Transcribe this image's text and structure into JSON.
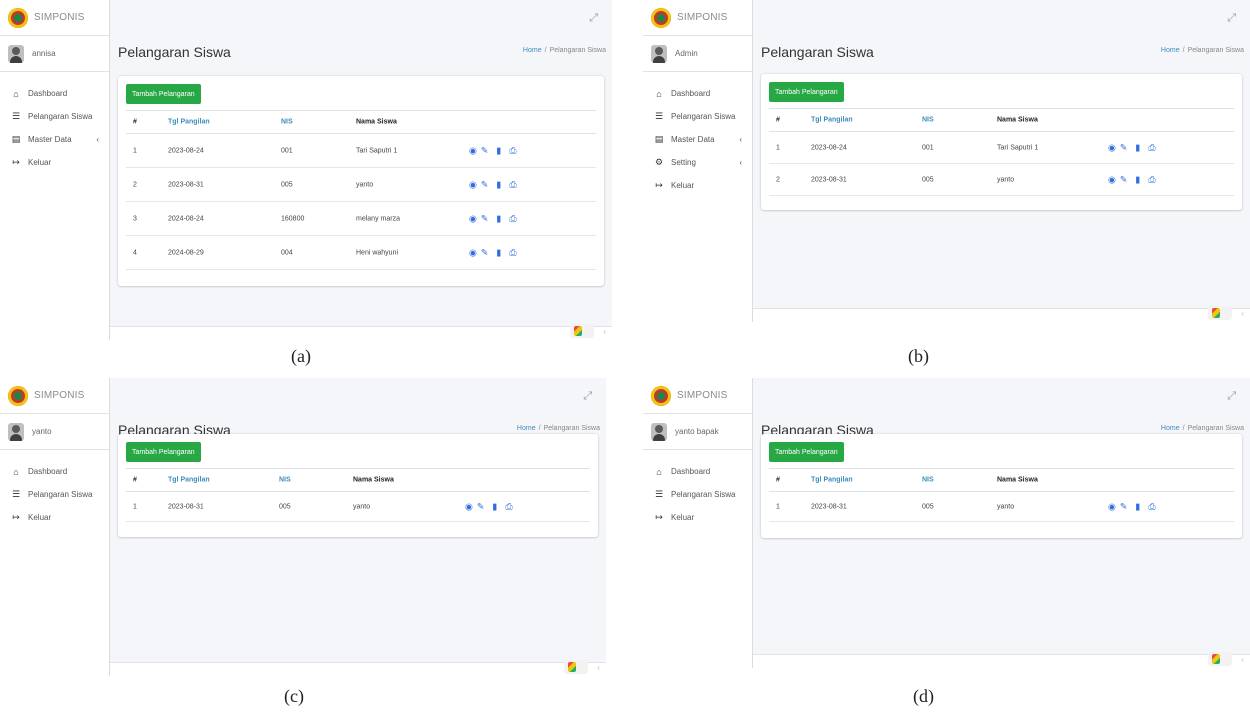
{
  "panels": [
    {
      "caption": "(a)",
      "brand": "SIMPONIS",
      "user": "annisa",
      "menu": [
        {
          "icon": "home-icon",
          "glyph": "⌂",
          "label": "Dashboard",
          "chevron": false
        },
        {
          "icon": "list-icon",
          "glyph": "☰",
          "label": "Pelangaran Siswa",
          "chevron": false
        },
        {
          "icon": "database-icon",
          "glyph": "▤",
          "label": "Master Data",
          "chevron": true
        },
        {
          "icon": "logout-icon",
          "glyph": "↦",
          "label": "Keluar",
          "chevron": false
        }
      ],
      "title": "Pelangaran Siswa",
      "breadcrumb": {
        "home": "Home",
        "sep": "/",
        "current": "Pelangaran Siswa"
      },
      "add_button": "Tambah Pelangaran",
      "headers": [
        "#",
        "Tgl Pangilan",
        "NIS",
        "Nama Siswa"
      ],
      "rows": [
        [
          "1",
          "2023-08-24",
          "001",
          "Tari Saputri 1"
        ],
        [
          "2",
          "2023-08-31",
          "005",
          "yanto"
        ],
        [
          "3",
          "2024-08-24",
          "160800",
          "melany marza"
        ],
        [
          "4",
          "2024-08-29",
          "004",
          "Heni wahyuni"
        ]
      ]
    },
    {
      "caption": "(b)",
      "brand": "SIMPONIS",
      "user": "Admin",
      "menu": [
        {
          "icon": "home-icon",
          "glyph": "⌂",
          "label": "Dashboard",
          "chevron": false
        },
        {
          "icon": "list-icon",
          "glyph": "☰",
          "label": "Pelangaran Siswa",
          "chevron": false
        },
        {
          "icon": "database-icon",
          "glyph": "▤",
          "label": "Master Data",
          "chevron": true
        },
        {
          "icon": "gear-icon",
          "glyph": "⚙",
          "label": "Setting",
          "chevron": true
        },
        {
          "icon": "logout-icon",
          "glyph": "↦",
          "label": "Keluar",
          "chevron": false
        }
      ],
      "title": "Pelangaran Siswa",
      "breadcrumb": {
        "home": "Home",
        "sep": "/",
        "current": "Pelangaran Siswa"
      },
      "add_button": "Tambah Pelangaran",
      "headers": [
        "#",
        "Tgl Pangilan",
        "NIS",
        "Nama Siswa"
      ],
      "rows": [
        [
          "1",
          "2023-08-24",
          "001",
          "Tari Saputri 1"
        ],
        [
          "2",
          "2023-08-31",
          "005",
          "yanto"
        ]
      ]
    },
    {
      "caption": "(c)",
      "brand": "SIMPONIS",
      "user": "yanto",
      "menu": [
        {
          "icon": "home-icon",
          "glyph": "⌂",
          "label": "Dashboard",
          "chevron": false
        },
        {
          "icon": "list-icon",
          "glyph": "☰",
          "label": "Pelangaran Siswa",
          "chevron": false
        },
        {
          "icon": "logout-icon",
          "glyph": "↦",
          "label": "Keluar",
          "chevron": false
        }
      ],
      "title": "Pelangaran Siswa",
      "breadcrumb": {
        "home": "Home",
        "sep": "/",
        "current": "Pelangaran Siswa"
      },
      "add_button": "Tambah Pelangaran",
      "headers": [
        "#",
        "Tgl Pangilan",
        "NIS",
        "Nama Siswa"
      ],
      "rows": [
        [
          "1",
          "2023-08-31",
          "005",
          "yanto"
        ]
      ]
    },
    {
      "caption": "(d)",
      "brand": "SIMPONIS",
      "user": "yanto bapak",
      "menu": [
        {
          "icon": "home-icon",
          "glyph": "⌂",
          "label": "Dashboard",
          "chevron": false
        },
        {
          "icon": "list-icon",
          "glyph": "☰",
          "label": "Pelangaran Siswa",
          "chevron": false
        },
        {
          "icon": "logout-icon",
          "glyph": "↦",
          "label": "Keluar",
          "chevron": false
        }
      ],
      "title": "Pelangaran Siswa",
      "breadcrumb": {
        "home": "Home",
        "sep": "/",
        "current": "Pelangaran Siswa"
      },
      "add_button": "Tambah Pelangaran",
      "headers": [
        "#",
        "Tgl Pangilan",
        "NIS",
        "Nama Siswa"
      ],
      "rows": [
        [
          "1",
          "2023-08-31",
          "005",
          "yanto"
        ]
      ]
    }
  ],
  "action_icons": [
    {
      "name": "view-icon",
      "glyph": "◉"
    },
    {
      "name": "edit-icon",
      "glyph": "✎"
    },
    {
      "name": "delete-icon",
      "glyph": "▮"
    },
    {
      "name": "print-icon",
      "glyph": "⎙"
    }
  ],
  "colors": {
    "accent": "#3c8dbc",
    "button": "#28a745",
    "action": "#2f6ee0",
    "background": "#f4f6f9"
  }
}
